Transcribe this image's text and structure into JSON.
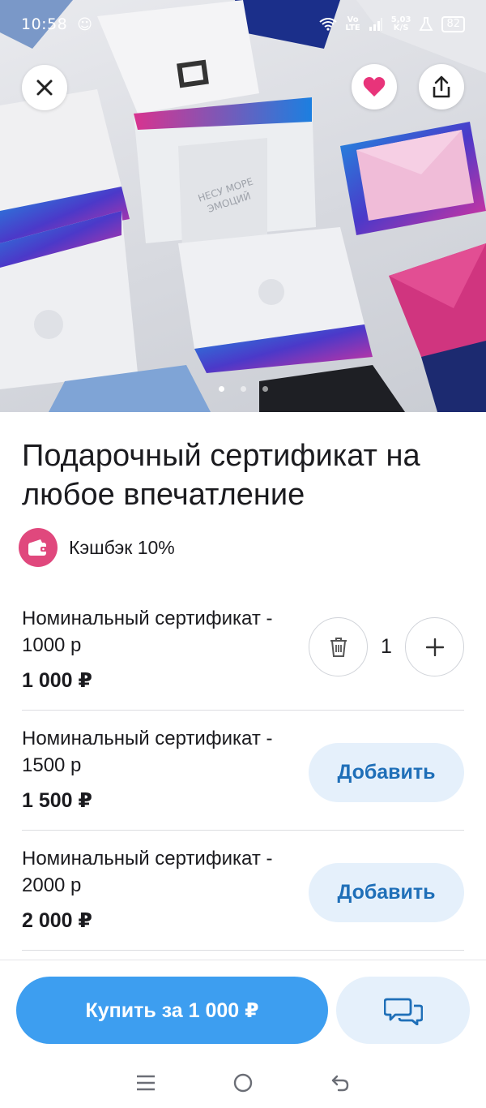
{
  "status_bar": {
    "time": "10:58",
    "network_top": "Vo",
    "network_bottom": "LTE",
    "speed_top": "5,03",
    "speed_bottom": "K/S",
    "battery": "82"
  },
  "hero": {
    "bag_text_line1": "НЕСУ МОРЕ",
    "bag_text_line2": "ЭМОЦИЙ",
    "carousel_pages": 3,
    "carousel_active": 1
  },
  "product": {
    "title": "Подарочный сертификат на любое впечатление",
    "cashback_label": "Кэшбэк 10%"
  },
  "items": [
    {
      "name": "Номинальный сертификат - 1000 р",
      "price": "1 000 ₽",
      "quantity": "1"
    },
    {
      "name": "Номинальный сертификат - 1500 р",
      "price": "1 500 ₽",
      "add_label": "Добавить"
    },
    {
      "name": "Номинальный сертификат - 2000 р",
      "price": "2 000 ₽",
      "add_label": "Добавить"
    }
  ],
  "bottom_bar": {
    "buy_label": "Купить за 1 000 ₽"
  },
  "icons": {
    "close": "close-icon",
    "favorite": "heart-icon",
    "share": "share-icon",
    "cashback": "wallet-icon",
    "delete": "trash-icon",
    "increase": "plus-icon",
    "chat": "chat-icon"
  },
  "colors": {
    "accent_blue": "#3d9ef0",
    "light_blue": "#e5f0fb",
    "action_text": "#1f6fb8",
    "pink": "#e0487d",
    "heart": "#e8347a"
  }
}
